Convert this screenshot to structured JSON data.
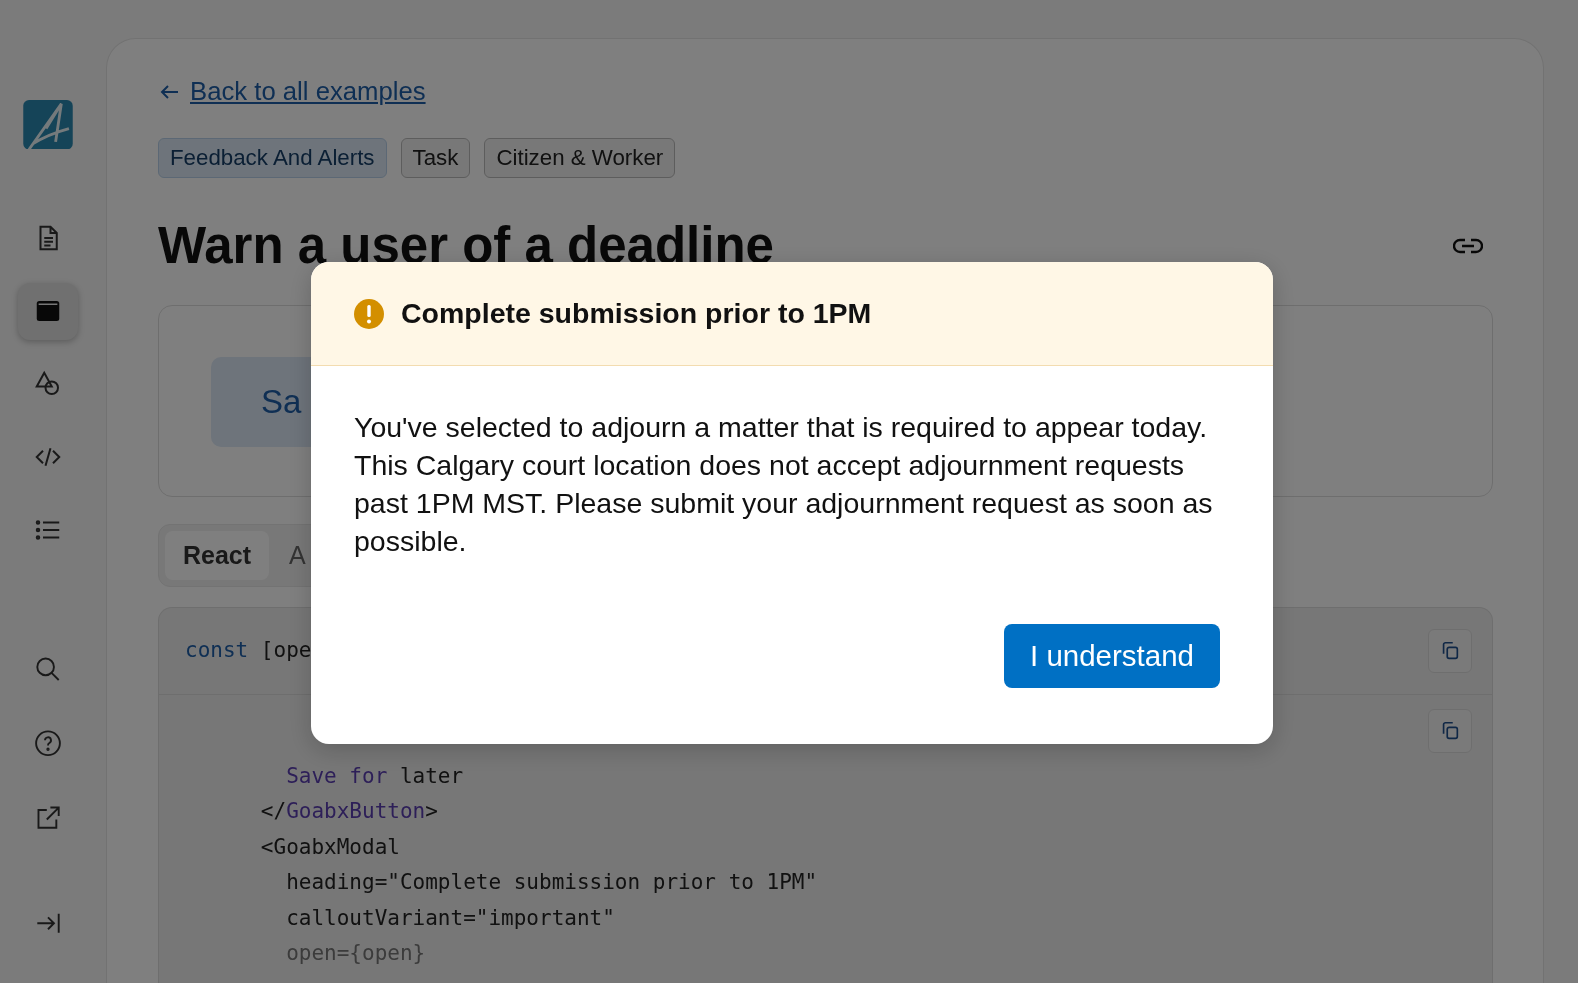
{
  "sidebar": {
    "items": [
      {
        "selected": false
      },
      {
        "selected": true
      },
      {
        "selected": false
      },
      {
        "selected": false
      },
      {
        "selected": false
      }
    ]
  },
  "back_link": "Back to all examples",
  "tags": [
    {
      "label": "Feedback And Alerts",
      "kind": "category"
    },
    {
      "label": "Task",
      "kind": "plain"
    },
    {
      "label": "Citizen & Worker",
      "kind": "plain"
    }
  ],
  "title": "Warn a user of a deadline",
  "preview": {
    "button": "Sa"
  },
  "tabs": [
    {
      "label": "React",
      "selected": true
    },
    {
      "label": "A",
      "selected": false
    }
  ],
  "code_header": [
    {
      "text": "const",
      "kind": "keyword"
    },
    {
      "text": " [ope",
      "kind": "plain"
    }
  ],
  "code_lines": [
    [
      {
        "text": "        Save for",
        "kind": "tag"
      },
      {
        "text": " later",
        "kind": "plain"
      }
    ],
    [
      {
        "text": "      </",
        "kind": "plain"
      },
      {
        "text": "GoabxButton",
        "kind": "tag"
      },
      {
        "text": ">",
        "kind": "plain"
      }
    ],
    [
      {
        "text": "      <GoabxModal",
        "kind": "plain"
      }
    ],
    [
      {
        "text": "        heading=\"Complete submission prior to 1PM\"",
        "kind": "plain"
      }
    ],
    [
      {
        "text": "        calloutVariant=\"important\"",
        "kind": "plain"
      }
    ],
    [
      {
        "text": "        open={open}",
        "kind": "muted"
      }
    ]
  ],
  "modal": {
    "heading": "Complete submission prior to 1PM",
    "body": "You've selected to adjourn a matter that is required to appear today. This Calgary court location does not accept adjournment requests past 1PM MST. Please submit your adjournment request as soon as possible.",
    "button": "I understand"
  }
}
